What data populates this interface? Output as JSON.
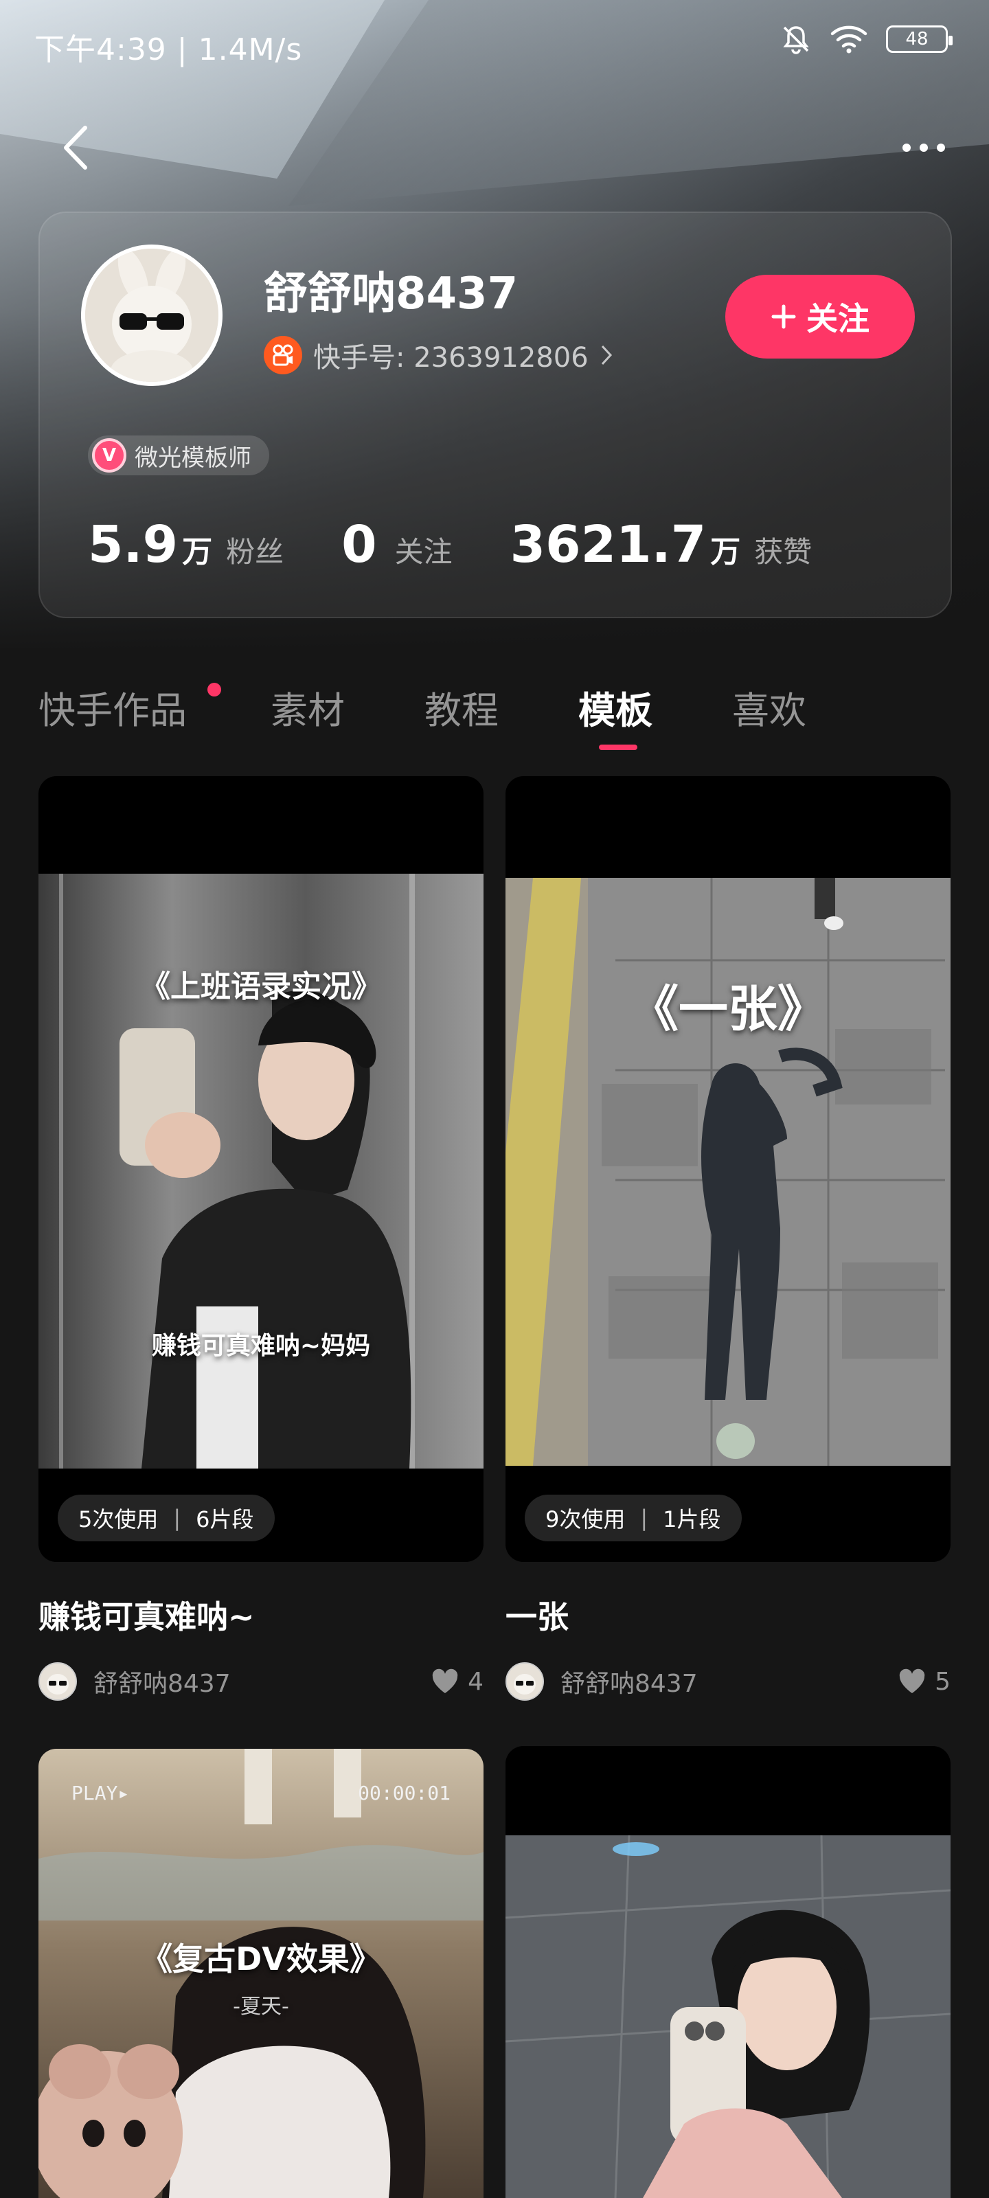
{
  "status_bar": {
    "time": "下午4:39 | 1.4M/s",
    "battery": "48"
  },
  "profile": {
    "name": "舒舒呐8437",
    "kwai_id": "快手号: 2363912806",
    "follow_label": "关注",
    "badge": "微光模板师",
    "badge_icon_letter": "V",
    "stats": [
      {
        "num": "5.9",
        "unit": "万",
        "label": "粉丝"
      },
      {
        "num": "0",
        "unit": "",
        "label": "关注"
      },
      {
        "num": "3621.7",
        "unit": "万",
        "label": "获赞"
      }
    ]
  },
  "tabs": [
    {
      "label": "快手作品",
      "has_dot": true
    },
    {
      "label": "素材"
    },
    {
      "label": "教程"
    },
    {
      "label": "模板",
      "active": true
    },
    {
      "label": "喜欢"
    }
  ],
  "cards": [
    {
      "overlay_title": "《上班语录实况》",
      "overlay_subtitle": "赚钱可真难呐~妈妈",
      "uses": "5次使用",
      "segments": "6片段",
      "title": "赚钱可真难呐~",
      "author": "舒舒呐8437",
      "likes": "4"
    },
    {
      "overlay_title": "《一张》",
      "uses": "9次使用",
      "segments": "1片段",
      "title": "一张",
      "author": "舒舒呐8437",
      "likes": "5"
    },
    {
      "overlay_title": "《复古DV效果》",
      "overlay_subtitle": "-夏天-",
      "play_label": "PLAY▸",
      "timecode": "00:00:01"
    },
    {}
  ],
  "colors": {
    "accent": "#fe3666",
    "kwai_orange": "#ff5a1f",
    "background": "#161616"
  }
}
